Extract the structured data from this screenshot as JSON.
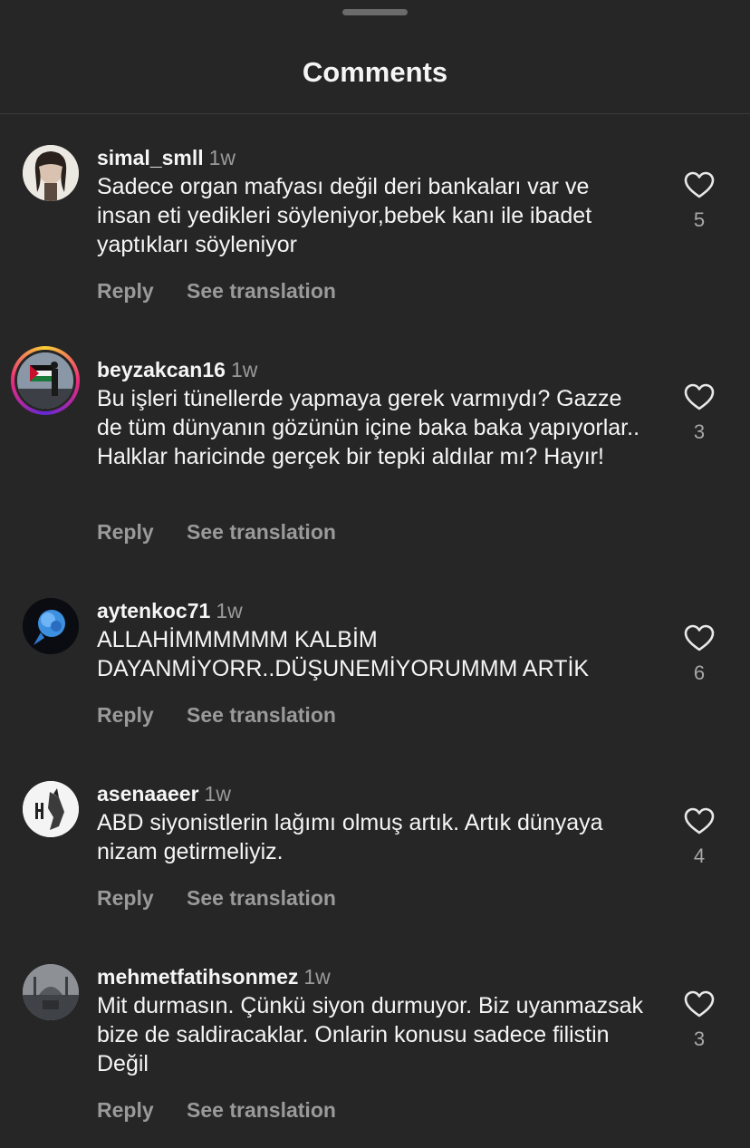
{
  "header": {
    "title": "Comments"
  },
  "actions": {
    "reply_label": "Reply",
    "translate_label": "See translation"
  },
  "comments": [
    {
      "username": "simal_smll",
      "time": "1w",
      "text": "Sadece organ mafyası değil deri bankaları var ve insan eti yedikleri söyleniyor,bebek kanı ile ibadet yaptıkları söyleniyor",
      "likes": "5",
      "has_story_ring": false
    },
    {
      "username": "beyzakcan16",
      "time": "1w",
      "text": "Bu işleri tünellerde yapmaya gerek varmıydı? Gazze de tüm dünyanın gözünün içine baka baka yapıyorlar.. Halklar haricinde gerçek bir tepki aldılar mı? Hayır!",
      "likes": "3",
      "has_story_ring": true
    },
    {
      "username": "aytenkoc71",
      "time": "1w",
      "text": "ALLAHİMMMMMM KALBİM DAYANMİYORR..DÜŞUNEMİYORUMMM ARTİK",
      "likes": "6",
      "has_story_ring": false
    },
    {
      "username": "asenaaeer",
      "time": "1w",
      "text": "ABD siyonistlerin lağımı olmuş artık. Artık dünyaya nizam getirmeliyiz.",
      "likes": "4",
      "has_story_ring": false
    },
    {
      "username": "mehmetfatihsonmez",
      "time": "1w",
      "text": "Mit durmasın. Çünkü siyon durmuyor. Biz uyanmazsak bize de saldiracaklar. Onlarin konusu sadece filistin Değil",
      "likes": "3",
      "has_story_ring": false
    }
  ]
}
